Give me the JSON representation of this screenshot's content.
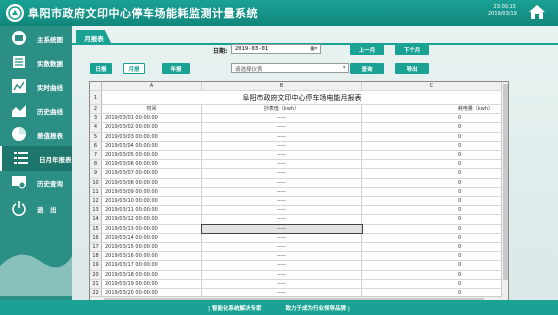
{
  "header": {
    "title": "阜阳市政府文印中心停车场能耗监测计量系统",
    "time": "23:00:15",
    "date": "2019/03/19"
  },
  "sidebar": {
    "items": [
      {
        "label": "主系统图",
        "icon": "diagram-icon"
      },
      {
        "label": "实数数据",
        "icon": "data-sheet-icon"
      },
      {
        "label": "实时曲线",
        "icon": "line-chart-icon"
      },
      {
        "label": "历史曲线",
        "icon": "area-chart-icon"
      },
      {
        "label": "差值报表",
        "icon": "pie-chart-icon"
      },
      {
        "label": "日月年报表",
        "icon": "list-icon",
        "active": true
      },
      {
        "label": "历史查询",
        "icon": "search-icon"
      },
      {
        "label": "退　出",
        "icon": "power-icon"
      }
    ]
  },
  "main": {
    "tab": "月报表",
    "date_label": "日期:",
    "date_value": "2019-03-01",
    "report_type_buttons": [
      "日报",
      "月报",
      "年报"
    ],
    "select_placeholder": "请选择仪表",
    "prev_month": "上一月",
    "next_month": "下个月",
    "query": "查询",
    "export": "导出"
  },
  "table": {
    "title": "阜阳市政府文印中心停车场电能月报表",
    "col_letters": [
      "A",
      "B",
      "C"
    ],
    "headers": [
      "时间",
      "抄表值（kwh）",
      "耗电量（kwh）"
    ],
    "rows": [
      [
        "2019/03/01 00:00:00",
        "-----",
        "0"
      ],
      [
        "2019/03/02 00:00:00",
        "-----",
        "0"
      ],
      [
        "2019/03/03 00:00:00",
        "-----",
        "0"
      ],
      [
        "2019/03/04 00:00:00",
        "-----",
        "0"
      ],
      [
        "2019/03/05 00:00:00",
        "-----",
        "0"
      ],
      [
        "2019/03/06 00:00:00",
        "-----",
        "0"
      ],
      [
        "2019/03/07 00:00:00",
        "-----",
        "0"
      ],
      [
        "2019/03/08 00:00:00",
        "-----",
        "0"
      ],
      [
        "2019/03/09 00:00:00",
        "-----",
        "0"
      ],
      [
        "2019/03/10 00:00:00",
        "-----",
        "0"
      ],
      [
        "2019/03/11 00:00:00",
        "-----",
        "0"
      ],
      [
        "2019/03/12 00:00:00",
        "-----",
        "0"
      ],
      [
        "2019/03/13 00:00:00",
        "-----",
        "0"
      ],
      [
        "2019/03/14 00:00:00",
        "-----",
        "0"
      ],
      [
        "2019/03/15 00:00:00",
        "-----",
        "0"
      ],
      [
        "2019/03/16 00:00:00",
        "-----",
        "0"
      ],
      [
        "2019/03/17 00:00:00",
        "-----",
        "0"
      ],
      [
        "2019/03/18 00:00:00",
        "-----",
        "0"
      ],
      [
        "2019/03/19 00:00:00",
        "-----",
        "0"
      ],
      [
        "2019/03/20 00:00:00",
        "-----",
        "0"
      ],
      [
        "2019/03/21 00:00:00",
        "-----",
        "0"
      ]
    ],
    "selected_row": 12
  },
  "footer": {
    "left": "| 智能化系统解决专家",
    "right": "致力于成为行业领导品牌 |"
  }
}
